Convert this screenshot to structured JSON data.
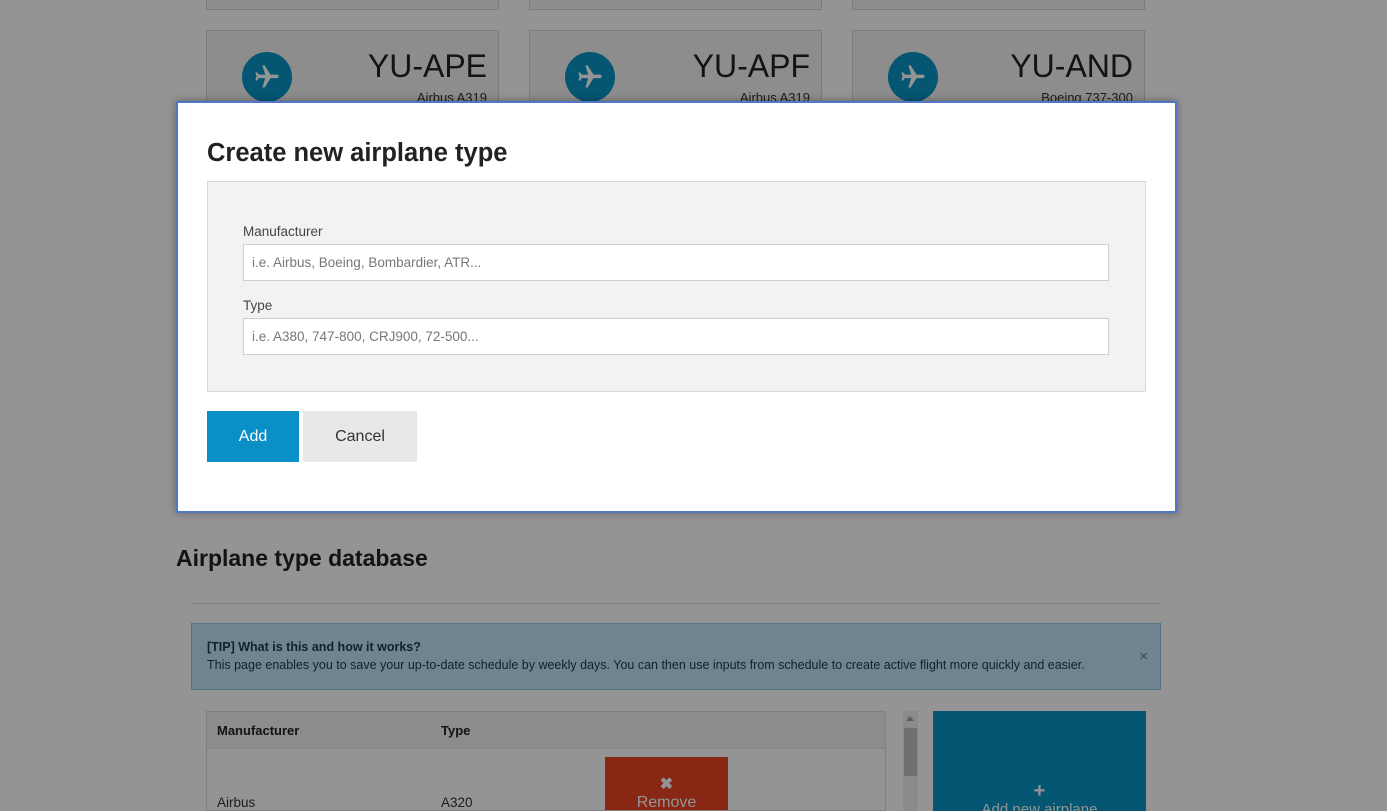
{
  "airplanes": [
    {
      "registration": "YU-APE",
      "model": "Airbus A319"
    },
    {
      "registration": "YU-APF",
      "model": "Airbus A319"
    },
    {
      "registration": "YU-AND",
      "model": "Boeing 737-300"
    }
  ],
  "airplane_icon": "airplane-icon",
  "section": {
    "title": "Airplane type database"
  },
  "tip": {
    "title": "[TIP] What is this and how it works?",
    "body": "This page enables you to save your up-to-date schedule by weekly days. You can then use inputs from schedule to create active flight more quickly and easier.",
    "close": "×"
  },
  "table": {
    "headers": [
      "Manufacturer",
      "Type"
    ],
    "rows": [
      {
        "manufacturer": "Airbus",
        "type": "A320",
        "remove_icon": "✖",
        "remove_label": "Remove"
      }
    ]
  },
  "add_tile": {
    "icon": "+",
    "label": "Add new airplane"
  },
  "modal": {
    "title": "Create new airplane type",
    "manufacturer_label": "Manufacturer",
    "manufacturer_placeholder": "i.e. Airbus, Boeing, Bombardier, ATR...",
    "manufacturer_value": "",
    "type_label": "Type",
    "type_placeholder": "i.e. A380, 747-800, CRJ900, 72-500...",
    "type_value": "",
    "add_label": "Add",
    "cancel_label": "Cancel"
  },
  "colors": {
    "accent": "#0795c6",
    "danger": "#e84424",
    "modal_border": "#5076c6"
  }
}
